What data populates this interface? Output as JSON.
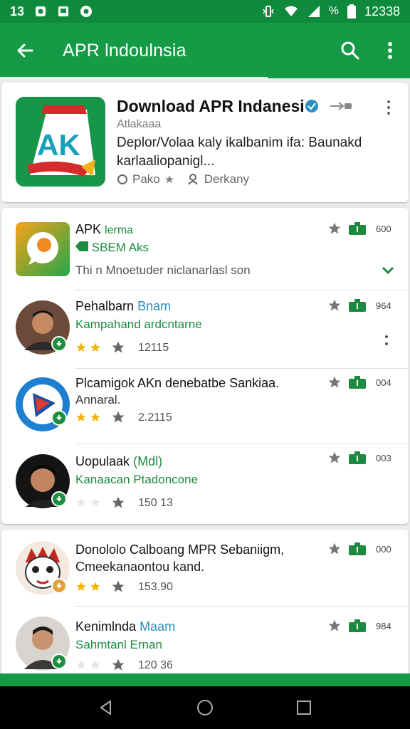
{
  "status_bar": {
    "left_time": "13",
    "battery_pct": "%",
    "clock": "12338"
  },
  "toolbar": {
    "title": "APR lndoulnsia"
  },
  "featured": {
    "title": "Download APR Indanesi",
    "subtitle": "Atlakaaa",
    "description": "Deplor/Volaa kaly ikalbanim ifa: Baunakd karlaaliopanigl...",
    "meta_left": "Pako",
    "meta_right": "Derkany"
  },
  "list1": [
    {
      "title": "APK",
      "title_accent": "lerma",
      "subtitle": "SBEM Aks",
      "description": "Thi n Mnoetuder niclanarlasl son",
      "stat": "600"
    },
    {
      "title": "Pehalbarn",
      "title_accent": "Bnam",
      "subtitle": "Kampahand ardcntarne",
      "count": "12115",
      "stat": "964"
    },
    {
      "title": "Plcamigok AKn denebatbe Sankiaa.",
      "subtitle2": "Annaral.",
      "count": "2.2115",
      "stat": "004"
    },
    {
      "title": "Uopulaak",
      "title_accent": "(Mdl)",
      "subtitle": "Kanaacan Ptadoncone",
      "count": "150 13",
      "stat": "003"
    }
  ],
  "list2": [
    {
      "title": "Donololo Calboang MPR Sebaniigm,",
      "subtitle2": "Cmeekanaontou kand.",
      "count": "153.90",
      "stat": "000"
    },
    {
      "title": "Kenimlnda",
      "title_accent": "Maam",
      "subtitle": "Sahmtanl Ernan",
      "count": "120 36",
      "stat": "984"
    }
  ],
  "colors": {
    "primary": "#159a45",
    "status": "#0f8a3c",
    "accent_text": "#1c8a3f",
    "star": "#f5b301",
    "link": "#2a8fc4"
  },
  "icons": [
    "back-arrow-icon",
    "search-icon",
    "more-vert-icon",
    "star-icon",
    "download-icon",
    "chevron-down-icon",
    "verified-icon",
    "share-icon"
  ]
}
